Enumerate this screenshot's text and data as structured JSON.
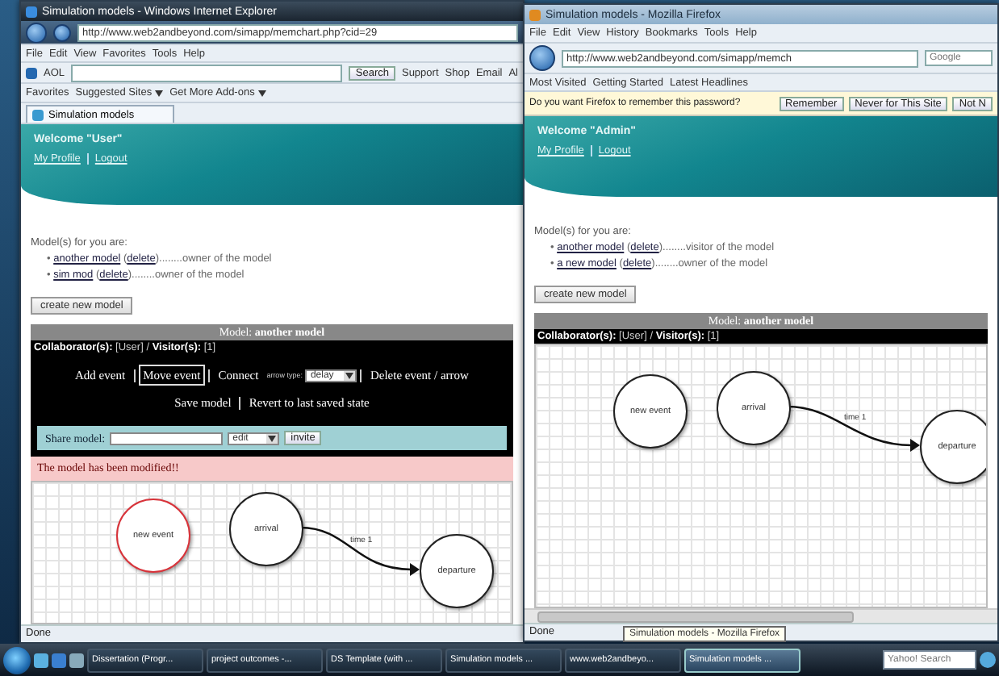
{
  "ie_window": {
    "title": "Simulation models - Windows Internet Explorer",
    "address": "http://www.web2andbeyond.com/simapp/memchart.php?cid=29",
    "menu": [
      "File",
      "Edit",
      "View",
      "Favorites",
      "Tools",
      "Help"
    ],
    "toolbar": {
      "brand": "AOL",
      "search_button": "Search",
      "links": [
        "Support",
        "Shop",
        "Email",
        "Al"
      ]
    },
    "favorites": [
      {
        "label": "Favorites",
        "dropdown": false
      },
      {
        "label": "Suggested Sites",
        "dropdown": true
      },
      {
        "label": "Get More Add-ons",
        "dropdown": true
      }
    ],
    "tabs": [
      {
        "label": "Simulation models",
        "selected": true
      }
    ],
    "page": {
      "welcome": "Welcome \"User\"",
      "links": [
        "My Profile",
        "Logout"
      ],
      "models_heading": "Model(s) for you are:",
      "models": [
        {
          "bullet": "•",
          "name": "another model",
          "open": "(",
          "delete": "delete",
          "role": ")........owner of the model"
        },
        {
          "bullet": "•",
          "name": "sim mod",
          "open": "(",
          "delete": "delete",
          "role": ")........owner of the model"
        }
      ],
      "create_button": "create new model",
      "model_title": "Model: **another model**",
      "collaborators": "**Collaborator(s):** [User] / **Visitor(s):** [1]",
      "editor": {
        "tools": [
          {
            "label": "Add event",
            "selected": false
          },
          {
            "label": "Move event",
            "selected": true
          },
          {
            "label": "Connect",
            "selected": false
          }
        ],
        "arrow_type_label": "arrow type:",
        "arrow_type": "delay",
        "delete_tool": "Delete event / arrow",
        "actions": [
          "Save model",
          "Revert to last saved state"
        ],
        "share": {
          "label": "Share model:",
          "permission": "edit",
          "button": "invite"
        }
      },
      "message": "The model has been modified!!",
      "nodes": [
        {
          "label": "new event",
          "selected": true
        },
        {
          "label": "arrival",
          "selected": false
        },
        {
          "label": "departure",
          "selected": false
        }
      ],
      "edge": {
        "label": "time 1"
      }
    },
    "status": "Done"
  },
  "firefox_window": {
    "title": "Simulation models - Mozilla Firefox",
    "menu": [
      "File",
      "Edit",
      "View",
      "History",
      "Bookmarks",
      "Tools",
      "Help"
    ],
    "address": "http://www.web2andbeyond.com/simapp/memch",
    "search_placeholder": "Google",
    "bookmarks": [
      "Most Visited",
      "Getting Started",
      "Latest Headlines"
    ],
    "password_bar": {
      "text": "Do you want Firefox to remember this password?",
      "buttons": [
        "Remember",
        "Never for This Site",
        "Not N"
      ]
    },
    "page": {
      "welcome": "Welcome \"Admin\"",
      "links": [
        "My Profile",
        "Logout"
      ],
      "models_heading": "Model(s) for you are:",
      "models": [
        {
          "bullet": "•",
          "name": "another model",
          "open": "(",
          "delete": "delete",
          "role": ")........visitor of the model"
        },
        {
          "bullet": "•",
          "name": "a new model",
          "open": "(",
          "delete": "delete",
          "role": ")........owner of the model"
        }
      ],
      "create_button": "create new model",
      "model_title": "Model: **another model**",
      "collaborators": "**Collaborator(s):** [User] / **Visitor(s):** [1]",
      "nodes": [
        {
          "label": "new event",
          "selected": false
        },
        {
          "label": "arrival",
          "selected": false
        },
        {
          "label": "departure",
          "selected": false
        }
      ],
      "edge": {
        "label": "time 1"
      }
    },
    "status": "Done"
  },
  "taskbar": {
    "items": [
      {
        "label": "Dissertation (Progr...",
        "selected": false
      },
      {
        "label": "project outcomes -...",
        "selected": false
      },
      {
        "label": "DS Template (with ...",
        "selected": false
      },
      {
        "label": "Simulation models ...",
        "selected": false
      },
      {
        "label": "www.web2andbeyo...",
        "selected": false
      },
      {
        "label": "Simulation models ...",
        "selected": true
      }
    ],
    "tooltip": "Simulation models - Mozilla Firefox",
    "search_placeholder": "Yahoo! Search"
  }
}
